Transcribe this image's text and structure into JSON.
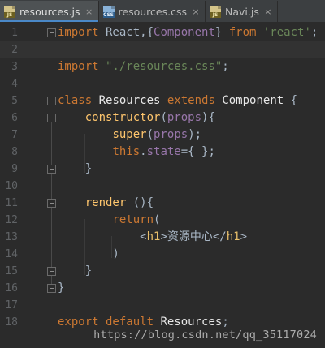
{
  "tabs": [
    {
      "label": "resources.js",
      "icon": "js-file-icon",
      "icon_text": "JS",
      "active": true
    },
    {
      "label": "resources.css",
      "icon": "css-file-icon",
      "icon_text": "CSS",
      "active": false
    },
    {
      "label": "Navi.js",
      "icon": "js-file-icon",
      "icon_text": "JS",
      "active": false
    }
  ],
  "tab_close_glyph": "×",
  "lines": [
    {
      "n": "1",
      "parts": [
        [
          "k",
          "import"
        ],
        [
          "p",
          " React,{"
        ],
        [
          "k2",
          "Component"
        ],
        [
          "p",
          "} "
        ],
        [
          "k",
          "from"
        ],
        [
          "s",
          " 'react'"
        ],
        [
          "p",
          ";"
        ]
      ]
    },
    {
      "n": "2",
      "parts": []
    },
    {
      "n": "3",
      "parts": [
        [
          "k",
          "import"
        ],
        [
          "s",
          " \"./resources.css\""
        ],
        [
          "p",
          ";"
        ]
      ]
    },
    {
      "n": "4",
      "parts": []
    },
    {
      "n": "5",
      "parts": [
        [
          "k",
          "class"
        ],
        [
          "cls",
          " Resources "
        ],
        [
          "k",
          "extends"
        ],
        [
          "cmp",
          " Component "
        ],
        [
          "p",
          "{"
        ]
      ]
    },
    {
      "n": "6",
      "parts": [
        [
          "p",
          "    "
        ],
        [
          "fn",
          "constructor"
        ],
        [
          "p",
          "("
        ],
        [
          "k2",
          "props"
        ],
        [
          "p",
          "){"
        ]
      ]
    },
    {
      "n": "7",
      "parts": [
        [
          "p",
          "        "
        ],
        [
          "fn",
          "super"
        ],
        [
          "p",
          "("
        ],
        [
          "k2",
          "props"
        ],
        [
          "p",
          ");"
        ]
      ]
    },
    {
      "n": "8",
      "parts": [
        [
          "p",
          "        "
        ],
        [
          "k",
          "this"
        ],
        [
          "p",
          "."
        ],
        [
          "k2",
          "state"
        ],
        [
          "p",
          "={ };"
        ]
      ]
    },
    {
      "n": "9",
      "parts": [
        [
          "p",
          "    }"
        ]
      ]
    },
    {
      "n": "10",
      "parts": []
    },
    {
      "n": "11",
      "parts": [
        [
          "p",
          "    "
        ],
        [
          "fn",
          "render"
        ],
        [
          "p",
          " (){"
        ]
      ]
    },
    {
      "n": "12",
      "parts": [
        [
          "p",
          "        "
        ],
        [
          "k",
          "return"
        ],
        [
          "p",
          "("
        ]
      ]
    },
    {
      "n": "13",
      "parts": [
        [
          "p",
          "            <"
        ],
        [
          "t",
          "h1"
        ],
        [
          "p",
          ">资源中心</"
        ],
        [
          "t",
          "h1"
        ],
        [
          "p",
          ">"
        ]
      ]
    },
    {
      "n": "14",
      "parts": [
        [
          "p",
          "        )"
        ]
      ]
    },
    {
      "n": "15",
      "parts": [
        [
          "p",
          "    }"
        ]
      ]
    },
    {
      "n": "16",
      "parts": [
        [
          "p",
          "}"
        ]
      ]
    },
    {
      "n": "17",
      "parts": []
    },
    {
      "n": "18",
      "parts": [
        [
          "k",
          "export default"
        ],
        [
          "cls",
          " Resources"
        ],
        [
          "p",
          ";"
        ]
      ]
    }
  ],
  "watermark": "https://blog.csdn.net/qq_35117024",
  "colors": {
    "background": "#2b2b2b",
    "keyword": "#cc7832",
    "purple": "#9876aa",
    "string": "#6a8759",
    "tag": "#e8bf6a",
    "text": "#a9b7c6",
    "line_number": "#606366"
  }
}
